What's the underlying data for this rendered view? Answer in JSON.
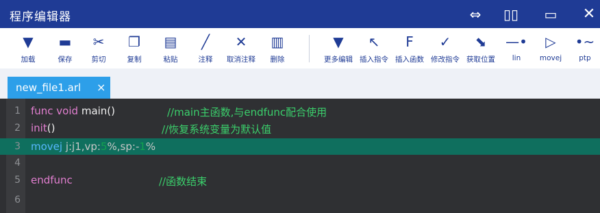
{
  "window": {
    "title": "程序编辑器"
  },
  "window_controls": {
    "swap": "⇔",
    "tile": "▯▯",
    "maximize": "▭",
    "close": "✕"
  },
  "toolbar": {
    "items": [
      {
        "label": "加载",
        "icon": "▼"
      },
      {
        "label": "保存",
        "icon": "▬"
      },
      {
        "label": "剪切",
        "icon": "✂"
      },
      {
        "label": "复制",
        "icon": "❐"
      },
      {
        "label": "粘贴",
        "icon": "▤"
      },
      {
        "label": "注释",
        "icon": "╱"
      },
      {
        "label": "取消注释",
        "icon": "✕"
      },
      {
        "label": "删除",
        "icon": "▥"
      },
      {
        "label": "更多编辑",
        "icon": "▼"
      },
      {
        "label": "插入指令",
        "icon": "↖"
      },
      {
        "label": "插入函数",
        "icon": "F"
      },
      {
        "label": "修改指令",
        "icon": "✓"
      },
      {
        "label": "获取位置",
        "icon": "⬊"
      },
      {
        "label": "lin",
        "icon": "—•"
      },
      {
        "label": "movej",
        "icon": "▷"
      },
      {
        "label": "ptp",
        "icon": "•~"
      }
    ]
  },
  "tab": {
    "name": "new_file1.arl",
    "close": "×"
  },
  "editor": {
    "lines": [
      {
        "num": "1",
        "kw": "func void",
        "code": " main()",
        "comment": "//main主函数,与endfunc配合使用"
      },
      {
        "num": "2",
        "kw": "init",
        "code": "()",
        "comment": "//恢复系统变量为默认值"
      },
      {
        "num": "3",
        "kw": "movej",
        "args_a": " j:j1,vp:",
        "v1": "5",
        "args_b": "%,sp:-",
        "v2": "1",
        "args_c": "%"
      },
      {
        "num": "4"
      },
      {
        "num": "5",
        "kw": "endfunc",
        "comment": "//函数结束"
      },
      {
        "num": "6"
      }
    ]
  },
  "colors": {
    "titlebar": "#1f3b95",
    "tab": "#2d9fe9",
    "editor_bg": "#2f3033",
    "active_line": "#0f6f5e",
    "comment": "#3bd06c",
    "keyword": "#e27fd0"
  }
}
